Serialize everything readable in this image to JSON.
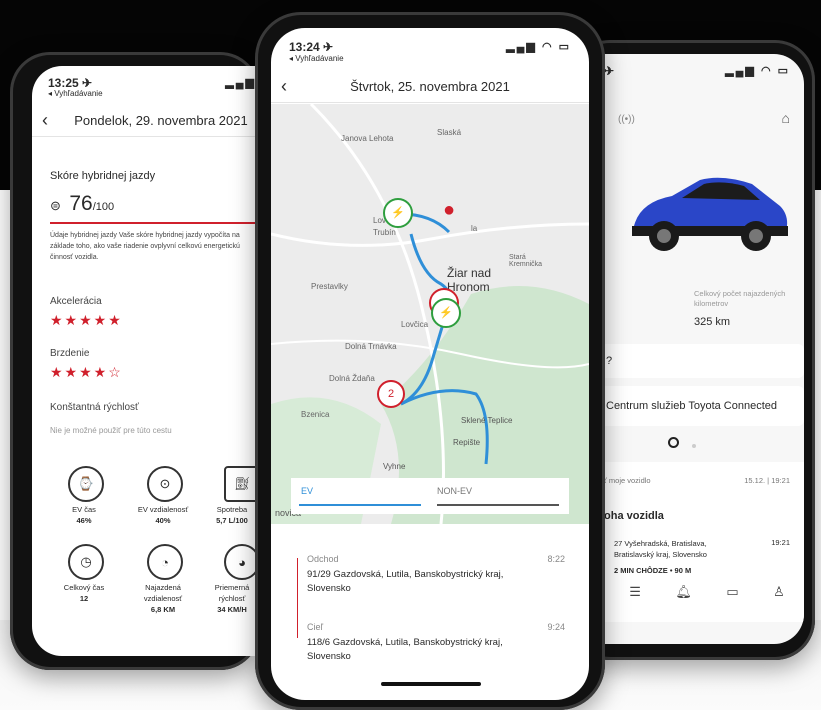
{
  "left": {
    "status_time": "13:25 ✈",
    "back_label": "◂ Vyhľadávanie",
    "date_title": "Pondelok, 29. novembra 2021",
    "score_heading": "Skóre hybridnej jazdy",
    "score_value": "76",
    "score_max": "/100",
    "description": "Údaje hybridnej jazdy Vaše skóre hybridnej jazdy vypočíta na základe toho, ako vaše riadenie ovplyvní celkovú energetickú činnosť vozidla.",
    "acceleration_label": "Akcelerácia",
    "acceleration_stars": "★★★★★",
    "braking_label": "Brzdenie",
    "braking_stars": "★★★★☆",
    "constant_speed_label": "Konštantná rýchlosť",
    "constant_speed_note": "Nie je možné použiť pre túto cestu",
    "stats": [
      {
        "label": "EV čas",
        "value": "46%"
      },
      {
        "label": "EV vzdialenosť",
        "value": "40%"
      },
      {
        "label": "Spotreba",
        "value": "5,7 L/100"
      },
      {
        "label": "Celkový čas",
        "value": "12"
      },
      {
        "label": "Najazdená vzdialenosť",
        "value": "6,8 KM"
      },
      {
        "label": "Priemerná rýchlosť",
        "value": "34 KM/H"
      }
    ]
  },
  "center": {
    "status_time": "13:24 ✈",
    "back_label": "◂ Vyhľadávanie",
    "date_title": "Štvrtok, 25. novembra 2021",
    "map_labels": [
      "Janova Lehota",
      "Slaská",
      "Lovča",
      "Trubín",
      "Žiar nad Hronom",
      "Stará Kremnička",
      "Prestavlky",
      "Lovčica",
      "Dolná Trnávka",
      "Dolná Ždaňa",
      "Bzenica",
      "Sklené Teplice",
      "Repište",
      "Vyhne",
      "novica",
      "la"
    ],
    "waypoint_number": "2",
    "tab_ev": "EV",
    "tab_non_ev": "NON-EV",
    "departure_label": "Odchod",
    "departure_time": "8:22",
    "departure_address": "91/29 Gazdovská, Lutila, Banskobystrický kraj, Slovensko",
    "arrival_label": "Cieľ",
    "arrival_time": "9:24",
    "arrival_address": "118/6 Gazdovská, Lutila, Banskobystrický kraj, Slovensko"
  },
  "right": {
    "odometer_label": "Celkový počet najazdených kilometrov",
    "odometer_value": "325 km",
    "question_fragment": "?",
    "service_center": "Centrum služieb Toyota Connected",
    "notice_source": "ť moje vozidlo",
    "notice_time": "15.12. | 19:21",
    "notice_title": "oha vozidla",
    "notice_address": "27 Vyšehradská, Bratislava, Bratislavský kraj, Slovensko",
    "notice_address_time": "19:21",
    "notice_walk": "2 MIN CHÔDZE • 90 M",
    "car_color": "#2a46c8"
  },
  "colors": {
    "accent_red": "#d0202c",
    "route_blue": "#2f8fd8",
    "green": "#2e9e3e"
  }
}
